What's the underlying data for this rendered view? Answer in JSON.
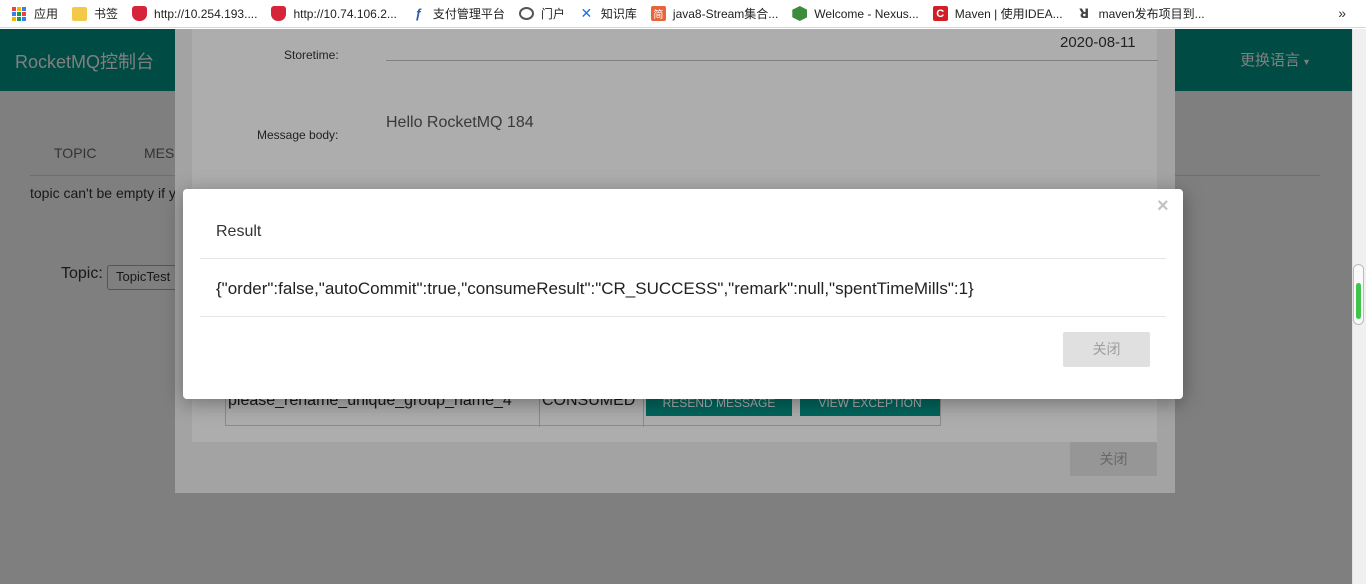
{
  "bookmarks": [
    {
      "label": "应用",
      "icon": "apps-grid-icon"
    },
    {
      "label": "书签",
      "icon": "folder-icon"
    },
    {
      "label": "http://10.254.193....",
      "icon": "shield-icon"
    },
    {
      "label": "http://10.74.106.2...",
      "icon": "shield-icon"
    },
    {
      "label": "支付管理平台",
      "icon": "pay-logo-icon"
    },
    {
      "label": "门户",
      "icon": "globe-icon"
    },
    {
      "label": "知识库",
      "icon": "confluence-icon"
    },
    {
      "label": "java8-Stream集合...",
      "icon": "jianshu-icon"
    },
    {
      "label": "Welcome - Nexus...",
      "icon": "nexus-icon"
    },
    {
      "label": "Maven | 使用IDEA...",
      "icon": "maven-icon"
    },
    {
      "label": "maven发布项目到...",
      "icon": "maven-alt-icon"
    }
  ],
  "bookmarks_more": "»",
  "navbar": {
    "brand": "RocketMQ控制台",
    "language": "更换语言",
    "caret": "▾"
  },
  "tabs": [
    "TOPIC",
    "MES"
  ],
  "warning_text": "topic can't be empty if y",
  "topic": {
    "label": "Topic:",
    "value": "TopicTest"
  },
  "message_modal": {
    "storetime_label": "Storetime:",
    "storetime_value": "2020-08-11",
    "body_label": "Message body:",
    "body_value": "Hello RocketMQ 184",
    "track_row": {
      "group": "please_rename_unique_group_name_4",
      "status": "CONSUMED",
      "resend_label": "RESEND MESSAGE",
      "view_exception_label": "VIEW EXCEPTION"
    },
    "close_label": "关闭"
  },
  "result_modal": {
    "title": "Result",
    "close_x": "×",
    "body": "{\"order\":false,\"autoCommit\":true,\"consumeResult\":\"CR_SUCCESS\",\"remark\":null,\"spentTimeMills\":1}",
    "close_label": "关闭"
  },
  "colors": {
    "navbar": "#009688",
    "button": "#009688"
  }
}
